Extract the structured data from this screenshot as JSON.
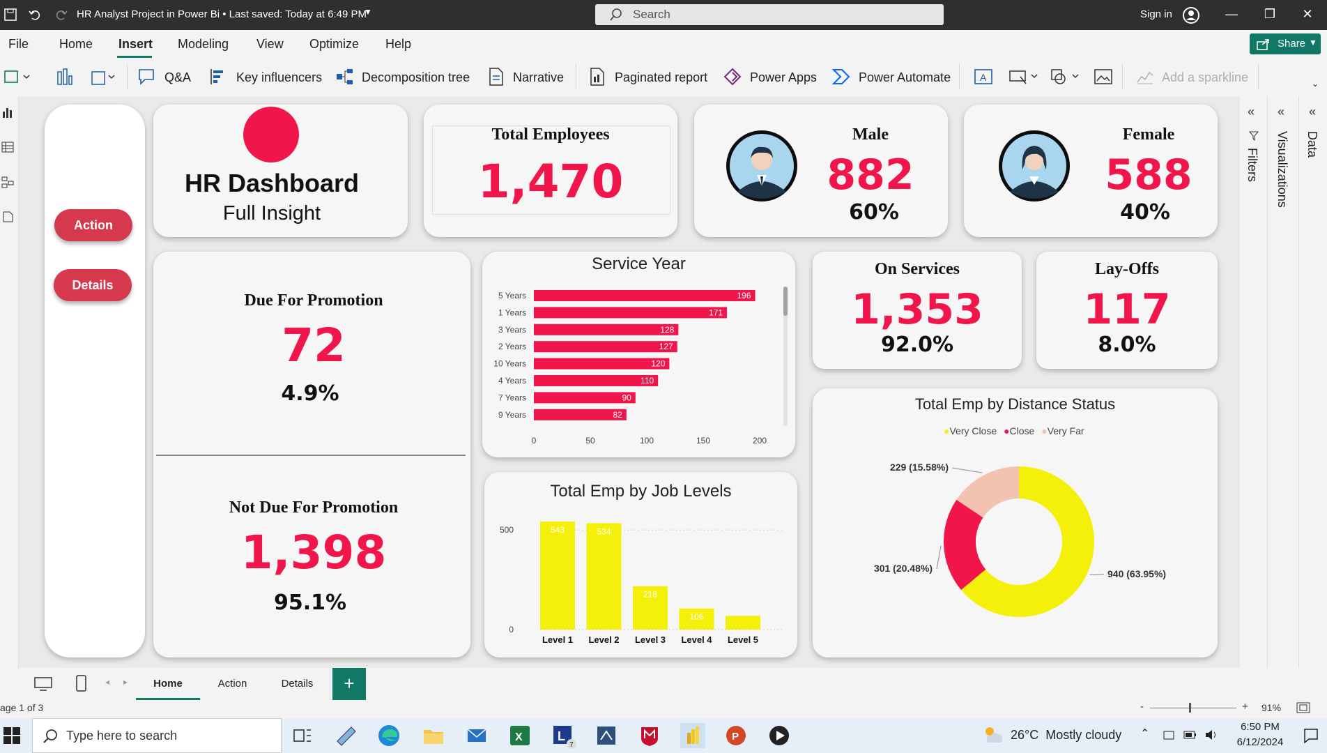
{
  "titlebar": {
    "title": "HR Analyst Project in Power Bi • Last saved: Today at 6:49 PM",
    "search_placeholder": "Search",
    "sign_in": "Sign in"
  },
  "menu": {
    "items": [
      "File",
      "Home",
      "Insert",
      "Modeling",
      "View",
      "Optimize",
      "Help"
    ],
    "active": "Insert",
    "share": "Share"
  },
  "toolbar": {
    "qa": "Q&A",
    "key_influencers": "Key influencers",
    "decomposition_tree": "Decomposition tree",
    "narrative": "Narrative",
    "paginated_report": "Paginated report",
    "power_apps": "Power Apps",
    "power_automate": "Power Automate",
    "add_sparkline": "Add a sparkline"
  },
  "nav": {
    "action": "Action",
    "details": "Details"
  },
  "header_card": {
    "title": "HR Dashboard",
    "subtitle": "Full Insight"
  },
  "kpi": {
    "total_employees": {
      "label": "Total Employees",
      "value": "1,470"
    },
    "male": {
      "label": "Male",
      "value": "882",
      "pct": "60%"
    },
    "female": {
      "label": "Female",
      "value": "588",
      "pct": "40%"
    },
    "due": {
      "label": "Due For Promotion",
      "value": "72",
      "pct": "4.9%"
    },
    "not_due": {
      "label": "Not Due For Promotion",
      "value": "1,398",
      "pct": "95.1%"
    },
    "on_services": {
      "label": "On Services",
      "value": "1,353",
      "pct": "92.0%"
    },
    "layoffs": {
      "label": "Lay-Offs",
      "value": "117",
      "pct": "8.0%"
    }
  },
  "chart_data": [
    {
      "type": "bar",
      "orientation": "horizontal",
      "title": "Service Year",
      "categories": [
        "5 Years",
        "1 Years",
        "3 Years",
        "2 Years",
        "10 Years",
        "4 Years",
        "7 Years",
        "9 Years"
      ],
      "values": [
        196,
        171,
        128,
        127,
        120,
        110,
        90,
        82
      ],
      "xticks": [
        "0",
        "50",
        "100",
        "150",
        "200"
      ],
      "xlim": [
        0,
        200
      ],
      "color": "#f0154a"
    },
    {
      "type": "bar",
      "title": "Total Emp by Job Levels",
      "categories": [
        "Level 1",
        "Level 2",
        "Level 3",
        "Level 4",
        "Level 5"
      ],
      "values": [
        543,
        534,
        218,
        106,
        69
      ],
      "data_labels": [
        "543",
        "534",
        "218",
        "106",
        ""
      ],
      "yticks": [
        "0",
        "500"
      ],
      "ylim": [
        0,
        560
      ],
      "color": "#f5f00a"
    },
    {
      "type": "pie",
      "donut": true,
      "title": "Total Emp by Distance Status",
      "legend_position": "top",
      "labels": [
        "Very Close",
        "Close",
        "Very Far"
      ],
      "values": [
        940,
        301,
        229
      ],
      "data_labels": [
        "940 (63.95%)",
        "301 (20.48%)",
        "229 (15.58%)"
      ],
      "colors": [
        "#f5f00a",
        "#f0154a",
        "#f3c2b0"
      ]
    }
  ],
  "panes": {
    "filters": "Filters",
    "visualizations": "Visualizations",
    "data": "Data"
  },
  "pages": {
    "tabs": [
      "Home",
      "Action",
      "Details"
    ],
    "active": "Home",
    "status": "age 1 of 3",
    "zoom": "91%"
  },
  "taskbar": {
    "search": "Type here to search",
    "weather": "26°C  Mostly cloudy",
    "time": "6:50 PM",
    "date": "6/12/2024"
  }
}
